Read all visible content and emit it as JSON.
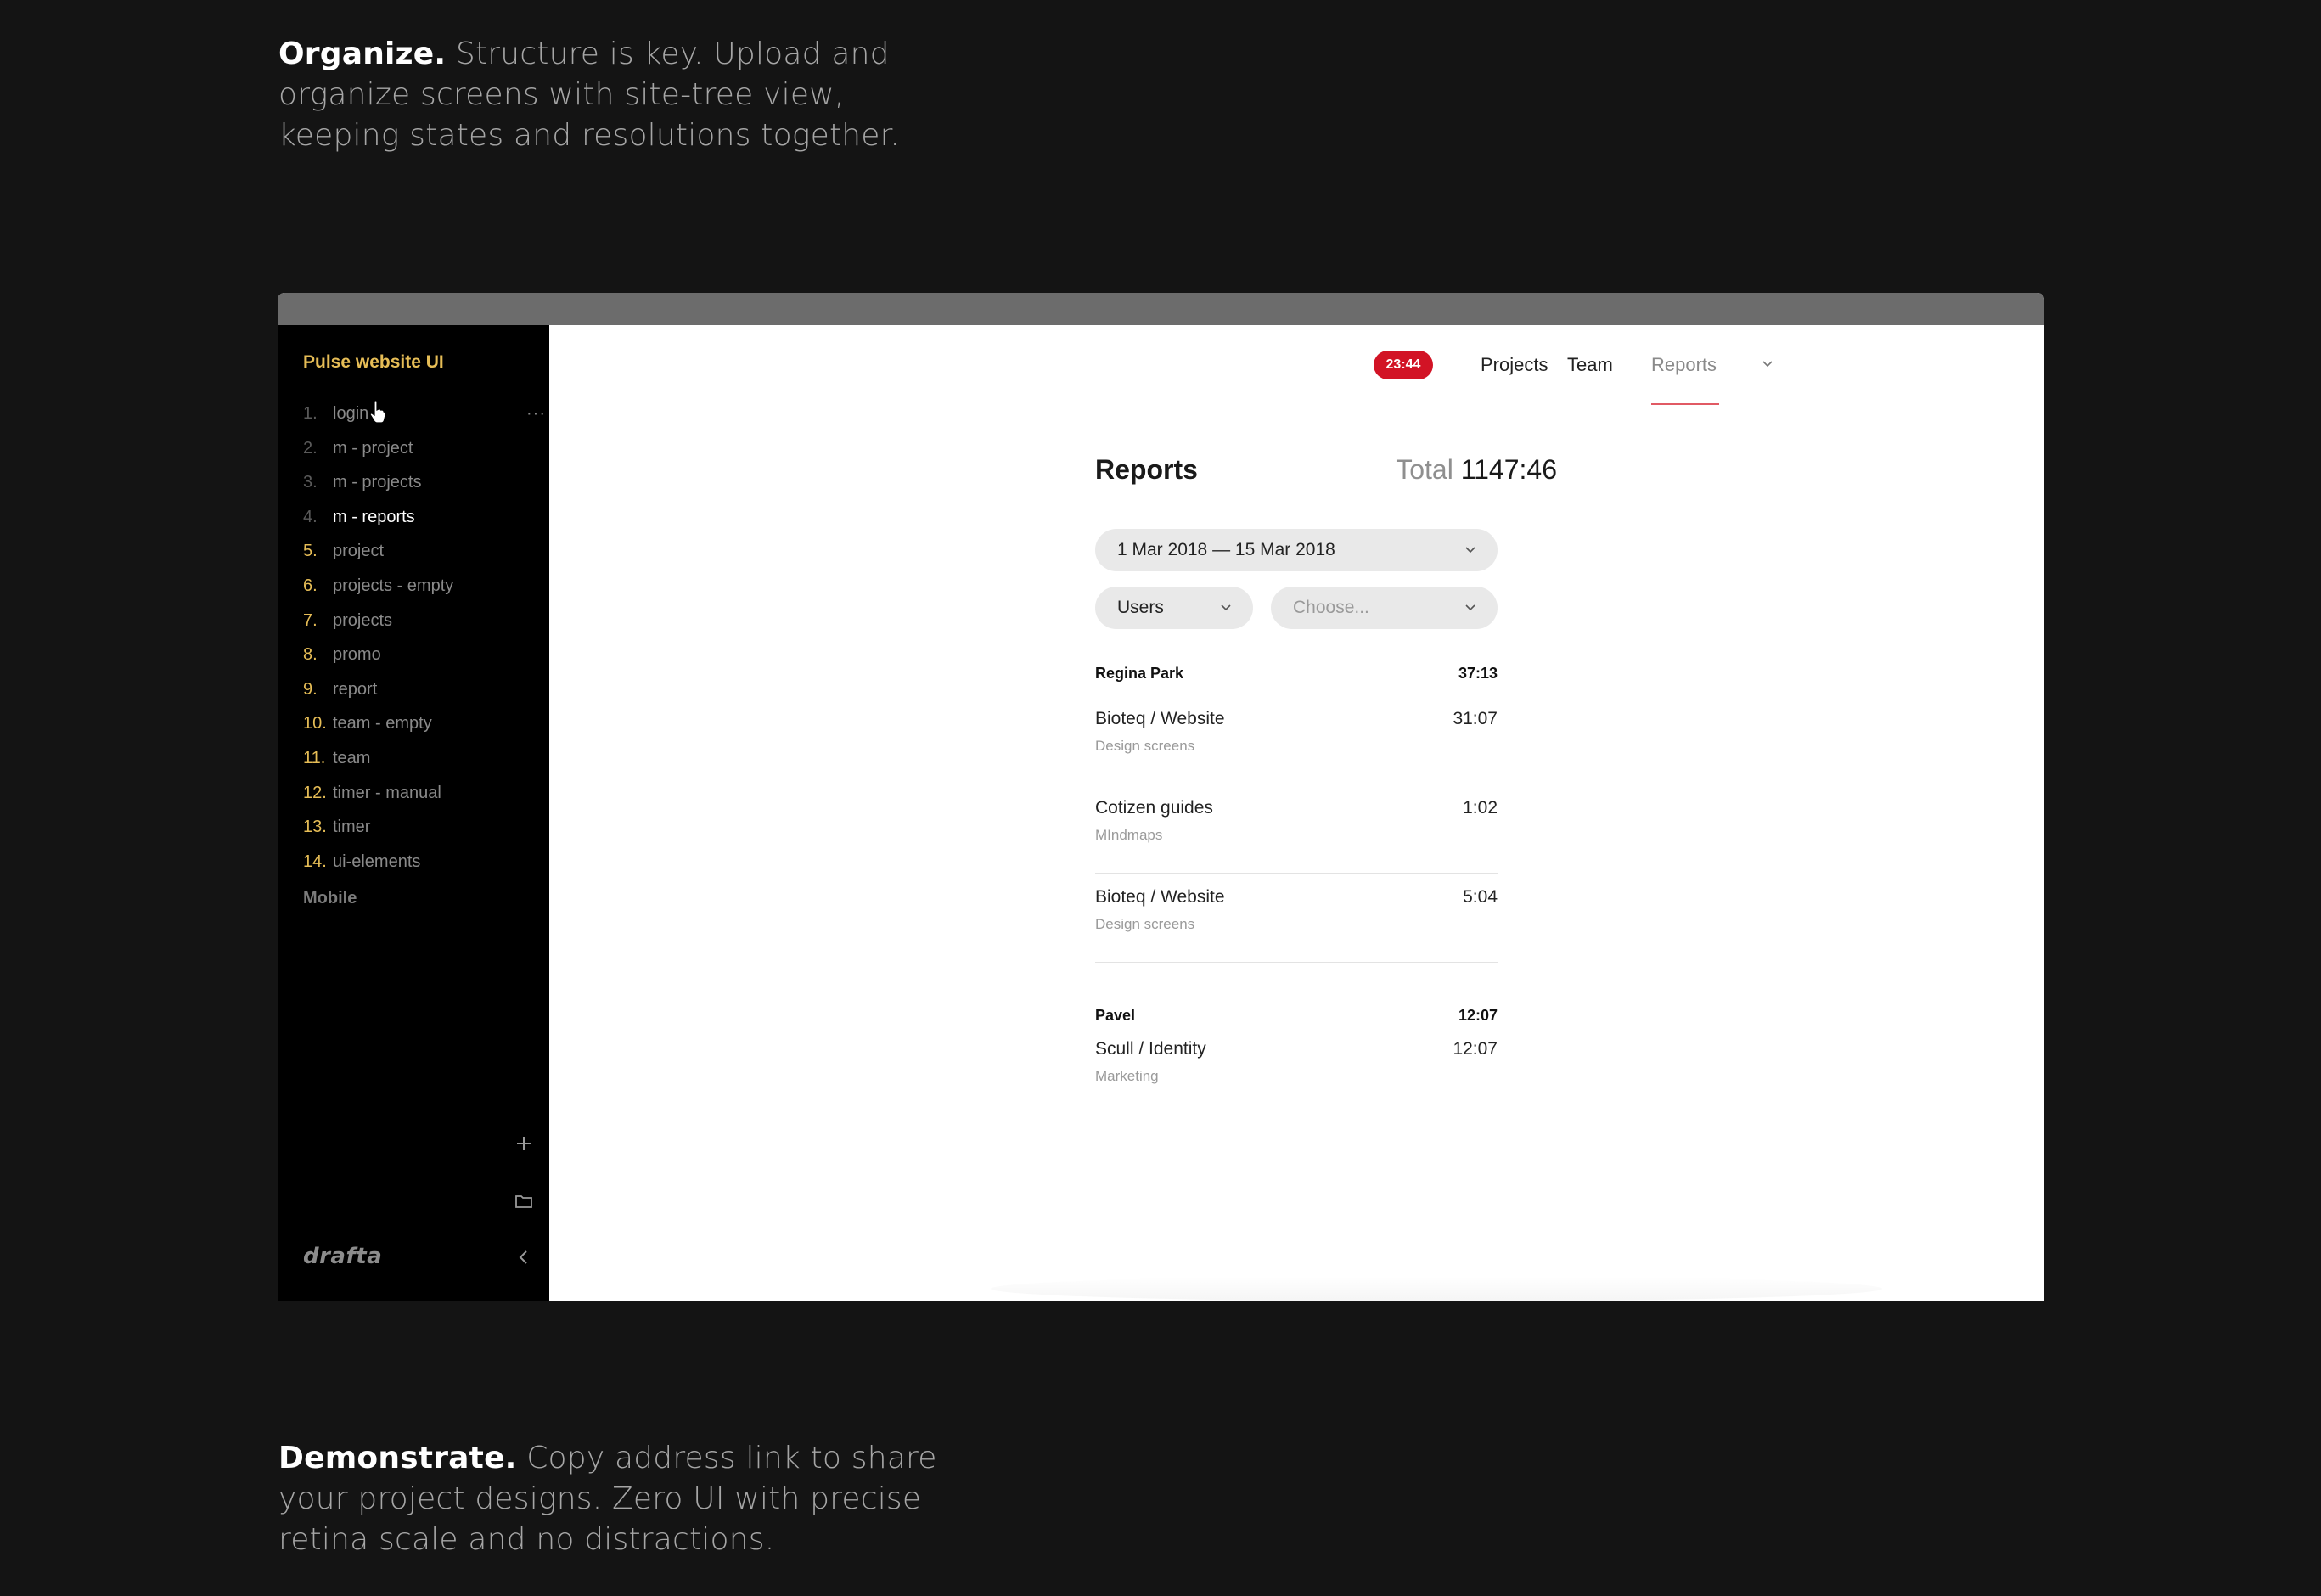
{
  "promo_top": {
    "heading": "Organize.",
    "text": "Structure is key. Upload and organize screens with site-tree view, keeping states and resolutions together."
  },
  "promo_bottom": {
    "heading": "Demonstrate.",
    "text": "Copy address link to share your project designs. Zero UI with precise retina scale and no distractions."
  },
  "sidebar": {
    "project_title": "Pulse website UI",
    "screens": [
      {
        "num": "1.",
        "label": "login"
      },
      {
        "num": "2.",
        "label": "m - project"
      },
      {
        "num": "3.",
        "label": "m - projects"
      },
      {
        "num": "4.",
        "label": "m - reports"
      },
      {
        "num": "5.",
        "label": "project"
      },
      {
        "num": "6.",
        "label": "projects - empty"
      },
      {
        "num": "7.",
        "label": "projects"
      },
      {
        "num": "8.",
        "label": "promo"
      },
      {
        "num": "9.",
        "label": "report"
      },
      {
        "num": "10.",
        "label": "team - empty"
      },
      {
        "num": "11.",
        "label": "team"
      },
      {
        "num": "12.",
        "label": "timer - manual"
      },
      {
        "num": "13.",
        "label": "timer"
      },
      {
        "num": "14.",
        "label": "ui-elements"
      }
    ],
    "more_label": "···",
    "group_label": "Mobile",
    "brand": "drafta",
    "accent_color": "#e6bd56"
  },
  "app": {
    "timer": "23:44",
    "tabs": {
      "projects": "Projects",
      "team": "Team",
      "reports": "Reports"
    },
    "title": "Reports",
    "total_label": "Total",
    "total_value": "1147:46",
    "date_range": "1 Mar 2018 — 15 Mar 2018",
    "filter_users": "Users",
    "filter_choose": "Choose...",
    "groups": [
      {
        "name": "Regina Park",
        "time": "37:13",
        "entries": [
          {
            "name": "Bioteq / Website",
            "sub": "Design screens",
            "time": "31:07"
          },
          {
            "name": "Cotizen guides",
            "sub": "MIndmaps",
            "time": "1:02"
          },
          {
            "name": "Bioteq / Website",
            "sub": "Design screens",
            "time": "5:04"
          }
        ]
      },
      {
        "name": "Pavel",
        "time": "12:07",
        "entries": [
          {
            "name": "Scull / Identity",
            "sub": "Marketing",
            "time": "12:07"
          }
        ]
      }
    ],
    "badge_color": "#d21325"
  }
}
